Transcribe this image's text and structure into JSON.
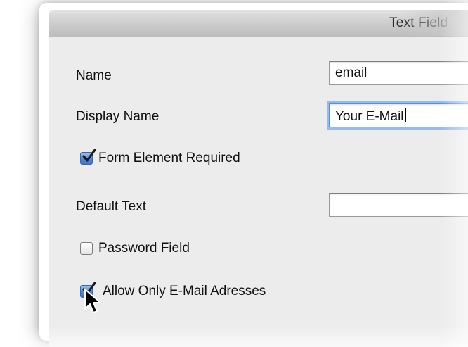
{
  "window": {
    "title": "Text Field"
  },
  "form": {
    "name_label": "Name",
    "name_value": "email",
    "display_name_label": "Display Name",
    "display_name_value": "Your E-Mail",
    "required_label": "Form Element Required",
    "required_checked": true,
    "default_text_label": "Default Text",
    "default_text_value": "",
    "password_label": "Password Field",
    "password_checked": false,
    "email_only_label": "Allow Only E-Mail Adresses",
    "email_only_checked": true
  },
  "colors": {
    "dialog_bg": "#ececec",
    "focus_ring": "#6ca0e6",
    "checkbox_checked": "#4f86d1"
  },
  "icons": {
    "checkmark": "checkmark-icon",
    "pointer": "mouse-pointer-icon"
  }
}
